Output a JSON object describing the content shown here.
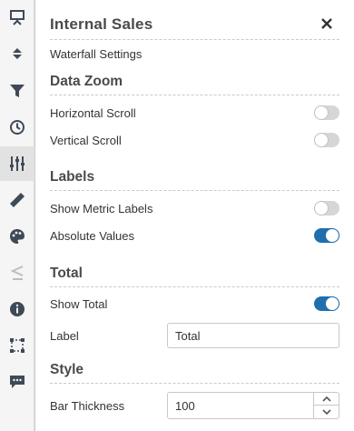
{
  "rail": {
    "items": [
      {
        "icon": "presentation-icon"
      },
      {
        "icon": "sort-icon"
      },
      {
        "icon": "filter-icon"
      },
      {
        "icon": "clock-icon"
      },
      {
        "icon": "sliders-icon",
        "active": true
      },
      {
        "icon": "ruler-icon"
      },
      {
        "icon": "palette-icon"
      },
      {
        "icon": "less-equal-icon",
        "disabled": true
      },
      {
        "icon": "info-icon"
      },
      {
        "icon": "selection-icon"
      },
      {
        "icon": "comment-icon"
      }
    ]
  },
  "panel": {
    "title": "Internal Sales",
    "subtitle": "Waterfall Settings",
    "data_zoom": {
      "heading": "Data Zoom",
      "horizontal_scroll": {
        "label": "Horizontal Scroll",
        "on": false
      },
      "vertical_scroll": {
        "label": "Vertical Scroll",
        "on": false
      }
    },
    "labels": {
      "heading": "Labels",
      "show_metric_labels": {
        "label": "Show Metric Labels",
        "on": false
      },
      "absolute_values": {
        "label": "Absolute Values",
        "on": true
      }
    },
    "total": {
      "heading": "Total",
      "show_total": {
        "label": "Show Total",
        "on": true
      },
      "label_field": {
        "label": "Label",
        "value": "Total"
      }
    },
    "style": {
      "heading": "Style",
      "bar_thickness": {
        "label": "Bar Thickness",
        "value": "100"
      }
    }
  },
  "colors": {
    "accent": "#1f6fad",
    "toggle_off": "#d6d6d6",
    "rail_bg": "#f5f5f5",
    "rail_icon": "#3f4a57"
  }
}
